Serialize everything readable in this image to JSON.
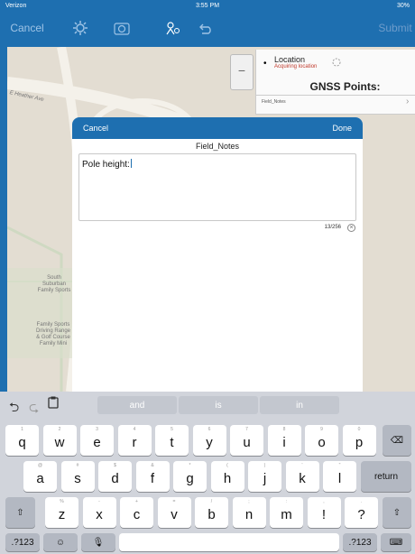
{
  "status": {
    "carrier": "Verizon",
    "time": "3:55 PM",
    "battery": "30%"
  },
  "nav": {
    "cancel": "Cancel",
    "submit": "Submit",
    "icons": [
      "gear-icon",
      "camera-icon",
      "location-icon",
      "undo-icon"
    ]
  },
  "map_labels": {
    "street": "E Heather Ave",
    "place1": "South Suburban Family Sports",
    "place2": "Family Sports Driving Range & Golf Course Family Mini"
  },
  "side_panel": {
    "location": "Location",
    "acquiring": "Acquiring location",
    "gnss": "GNSS Points:",
    "field_notes": "Field_Notes"
  },
  "dialog": {
    "cancel": "Cancel",
    "done": "Done",
    "title": "Field_Notes",
    "value": "Pole height:",
    "counter": "13/256"
  },
  "suggestions": [
    "and",
    "is",
    "in"
  ],
  "keys": {
    "row1": [
      [
        "q",
        "1"
      ],
      [
        "w",
        "2"
      ],
      [
        "e",
        "3"
      ],
      [
        "r",
        "4"
      ],
      [
        "t",
        "5"
      ],
      [
        "y",
        "6"
      ],
      [
        "u",
        "7"
      ],
      [
        "i",
        "8"
      ],
      [
        "o",
        "9"
      ],
      [
        "p",
        "0"
      ]
    ],
    "row2": [
      [
        "a",
        "@"
      ],
      [
        "s",
        "#"
      ],
      [
        "d",
        "$"
      ],
      [
        "f",
        "&"
      ],
      [
        "g",
        "*"
      ],
      [
        "h",
        "("
      ],
      [
        "j",
        ")"
      ],
      [
        "k",
        "'"
      ],
      [
        "l",
        "\""
      ]
    ],
    "row3": [
      [
        "z",
        "%"
      ],
      [
        "x",
        "-"
      ],
      [
        "c",
        "+"
      ],
      [
        "v",
        "="
      ],
      [
        "b",
        "/"
      ],
      [
        "n",
        ";"
      ],
      [
        "m",
        ":"
      ],
      [
        "!",
        ","
      ],
      [
        "?",
        "."
      ]
    ],
    "return": "return",
    "numbers": ".?123"
  }
}
